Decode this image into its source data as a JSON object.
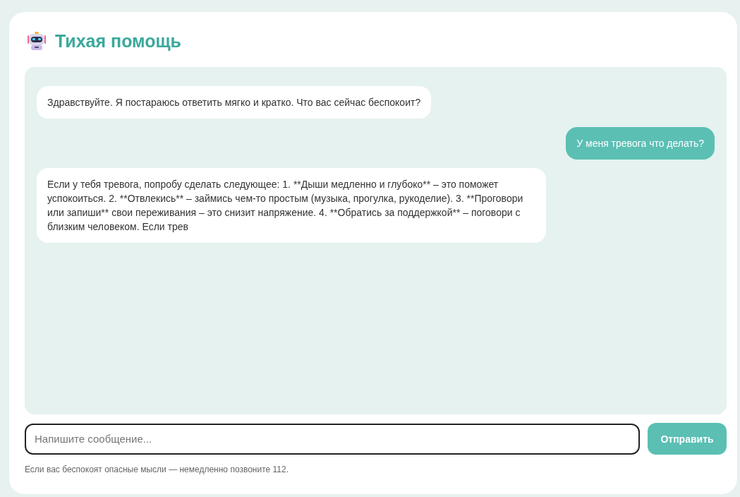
{
  "header": {
    "title": "Тихая помощь"
  },
  "messages": [
    {
      "kind": "bot",
      "text": "Здравствуйте. Я постараюсь ответить мягко и кратко. Что вас сейчас беспокоит?"
    },
    {
      "kind": "user",
      "text": "У меня тревога что делать?"
    },
    {
      "kind": "bot",
      "text": "Если у тебя тревога, попробу сделать следующее: 1. **Дыши медленно и глубоко** – это поможет успокоиться. 2. **Отвлекись** – займись чем-то простым (музыка, прогулка, рукоделие). 3. **Проговори или запиши** свои переживания – это снизит напряжение. 4. **Обратись за поддержкой** – поговори с близким человеком. Если трев"
    }
  ],
  "composer": {
    "placeholder": "Напишите сообщение...",
    "button": "Отправить"
  },
  "footer_note": "Если вас беспокоят опасные мысли — немедленно позвоните 112."
}
